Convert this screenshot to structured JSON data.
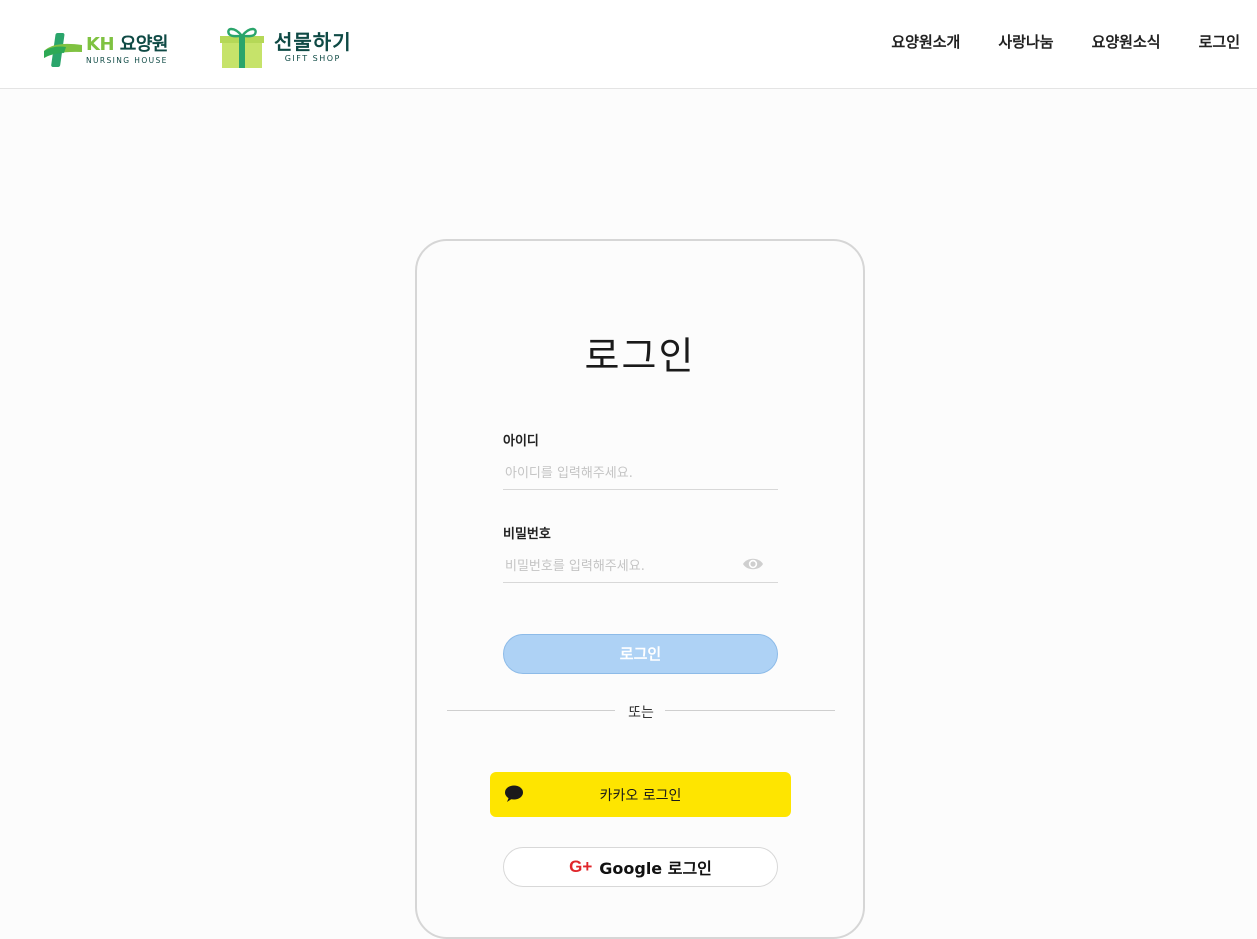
{
  "header": {
    "logo_kh": {
      "mark": "KH",
      "name": "요양원",
      "sub": "NURSING HOUSE"
    },
    "logo_gift": {
      "name": "선물하기",
      "sub": "GIFT SHOP"
    },
    "nav": [
      {
        "label": "요양원소개"
      },
      {
        "label": "사랑나눔"
      },
      {
        "label": "요양원소식"
      },
      {
        "label": "로그인"
      }
    ]
  },
  "login": {
    "title": "로그인",
    "id_label": "아이디",
    "id_placeholder": "아이디를 입력해주세요.",
    "pw_label": "비밀번호",
    "pw_placeholder": "비밀번호를 입력해주세요.",
    "submit_label": "로그인",
    "divider_text": "또는",
    "kakao_label": "카카오 로그인",
    "google_label": "Google 로그인",
    "google_icon_text": "G+"
  },
  "colors": {
    "kakao": "#fee500",
    "login_button": "#aed2f5",
    "brand_green": "#7fc241",
    "brand_dark": "#0f4a45",
    "google_red": "#e0262b"
  },
  "icons": {
    "eye": "eye-icon",
    "kakao": "chat-bubble-icon",
    "google": "google-plus-icon"
  }
}
